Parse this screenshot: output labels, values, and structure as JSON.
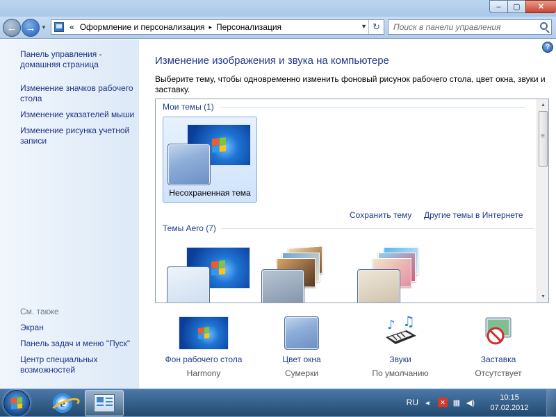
{
  "window": {
    "minimize": "‒",
    "maximize": "▢",
    "close": "✕"
  },
  "nav": {
    "breadcrumb_prefix": "«",
    "crumbs": [
      "Оформление и персонализация",
      "Персонализация"
    ],
    "separator": "▸",
    "search_placeholder": "Поиск в панели управления"
  },
  "sidebar": {
    "links": [
      "Панель управления - домашняя страница",
      "Изменение значков рабочего стола",
      "Изменение указателей мыши",
      "Изменение рисунка учетной записи"
    ],
    "see_also_title": "См. также",
    "see_also": [
      "Экран",
      "Панель задач и меню \"Пуск\"",
      "Центр специальных возможностей"
    ]
  },
  "main": {
    "title": "Изменение изображения и звука на компьютере",
    "description": "Выберите тему, чтобы одновременно изменить фоновый рисунок рабочего стола, цвет окна, звуки и заставку.",
    "my_themes_header": "Мои темы (1)",
    "unsaved_theme": "Несохраненная тема",
    "save_theme": "Сохранить тему",
    "more_themes": "Другие темы в Интернете",
    "aero_header": "Темы Aero (7)"
  },
  "bottom": [
    {
      "label": "Фон рабочего стола",
      "value": "Harmony",
      "icon": "desktop-background-icon"
    },
    {
      "label": "Цвет окна",
      "value": "Сумерки",
      "icon": "window-color-icon"
    },
    {
      "label": "Звуки",
      "value": "По умолчанию",
      "icon": "sounds-icon"
    },
    {
      "label": "Заставка",
      "value": "Отсутствует",
      "icon": "screensaver-icon"
    }
  ],
  "taskbar": {
    "language": "RU",
    "time": "10:15",
    "date": "07.02.2012"
  },
  "colors": {
    "accent": "#1e3a8a",
    "sidebar_link": "#1e3287",
    "taskbar": "#23496f"
  }
}
